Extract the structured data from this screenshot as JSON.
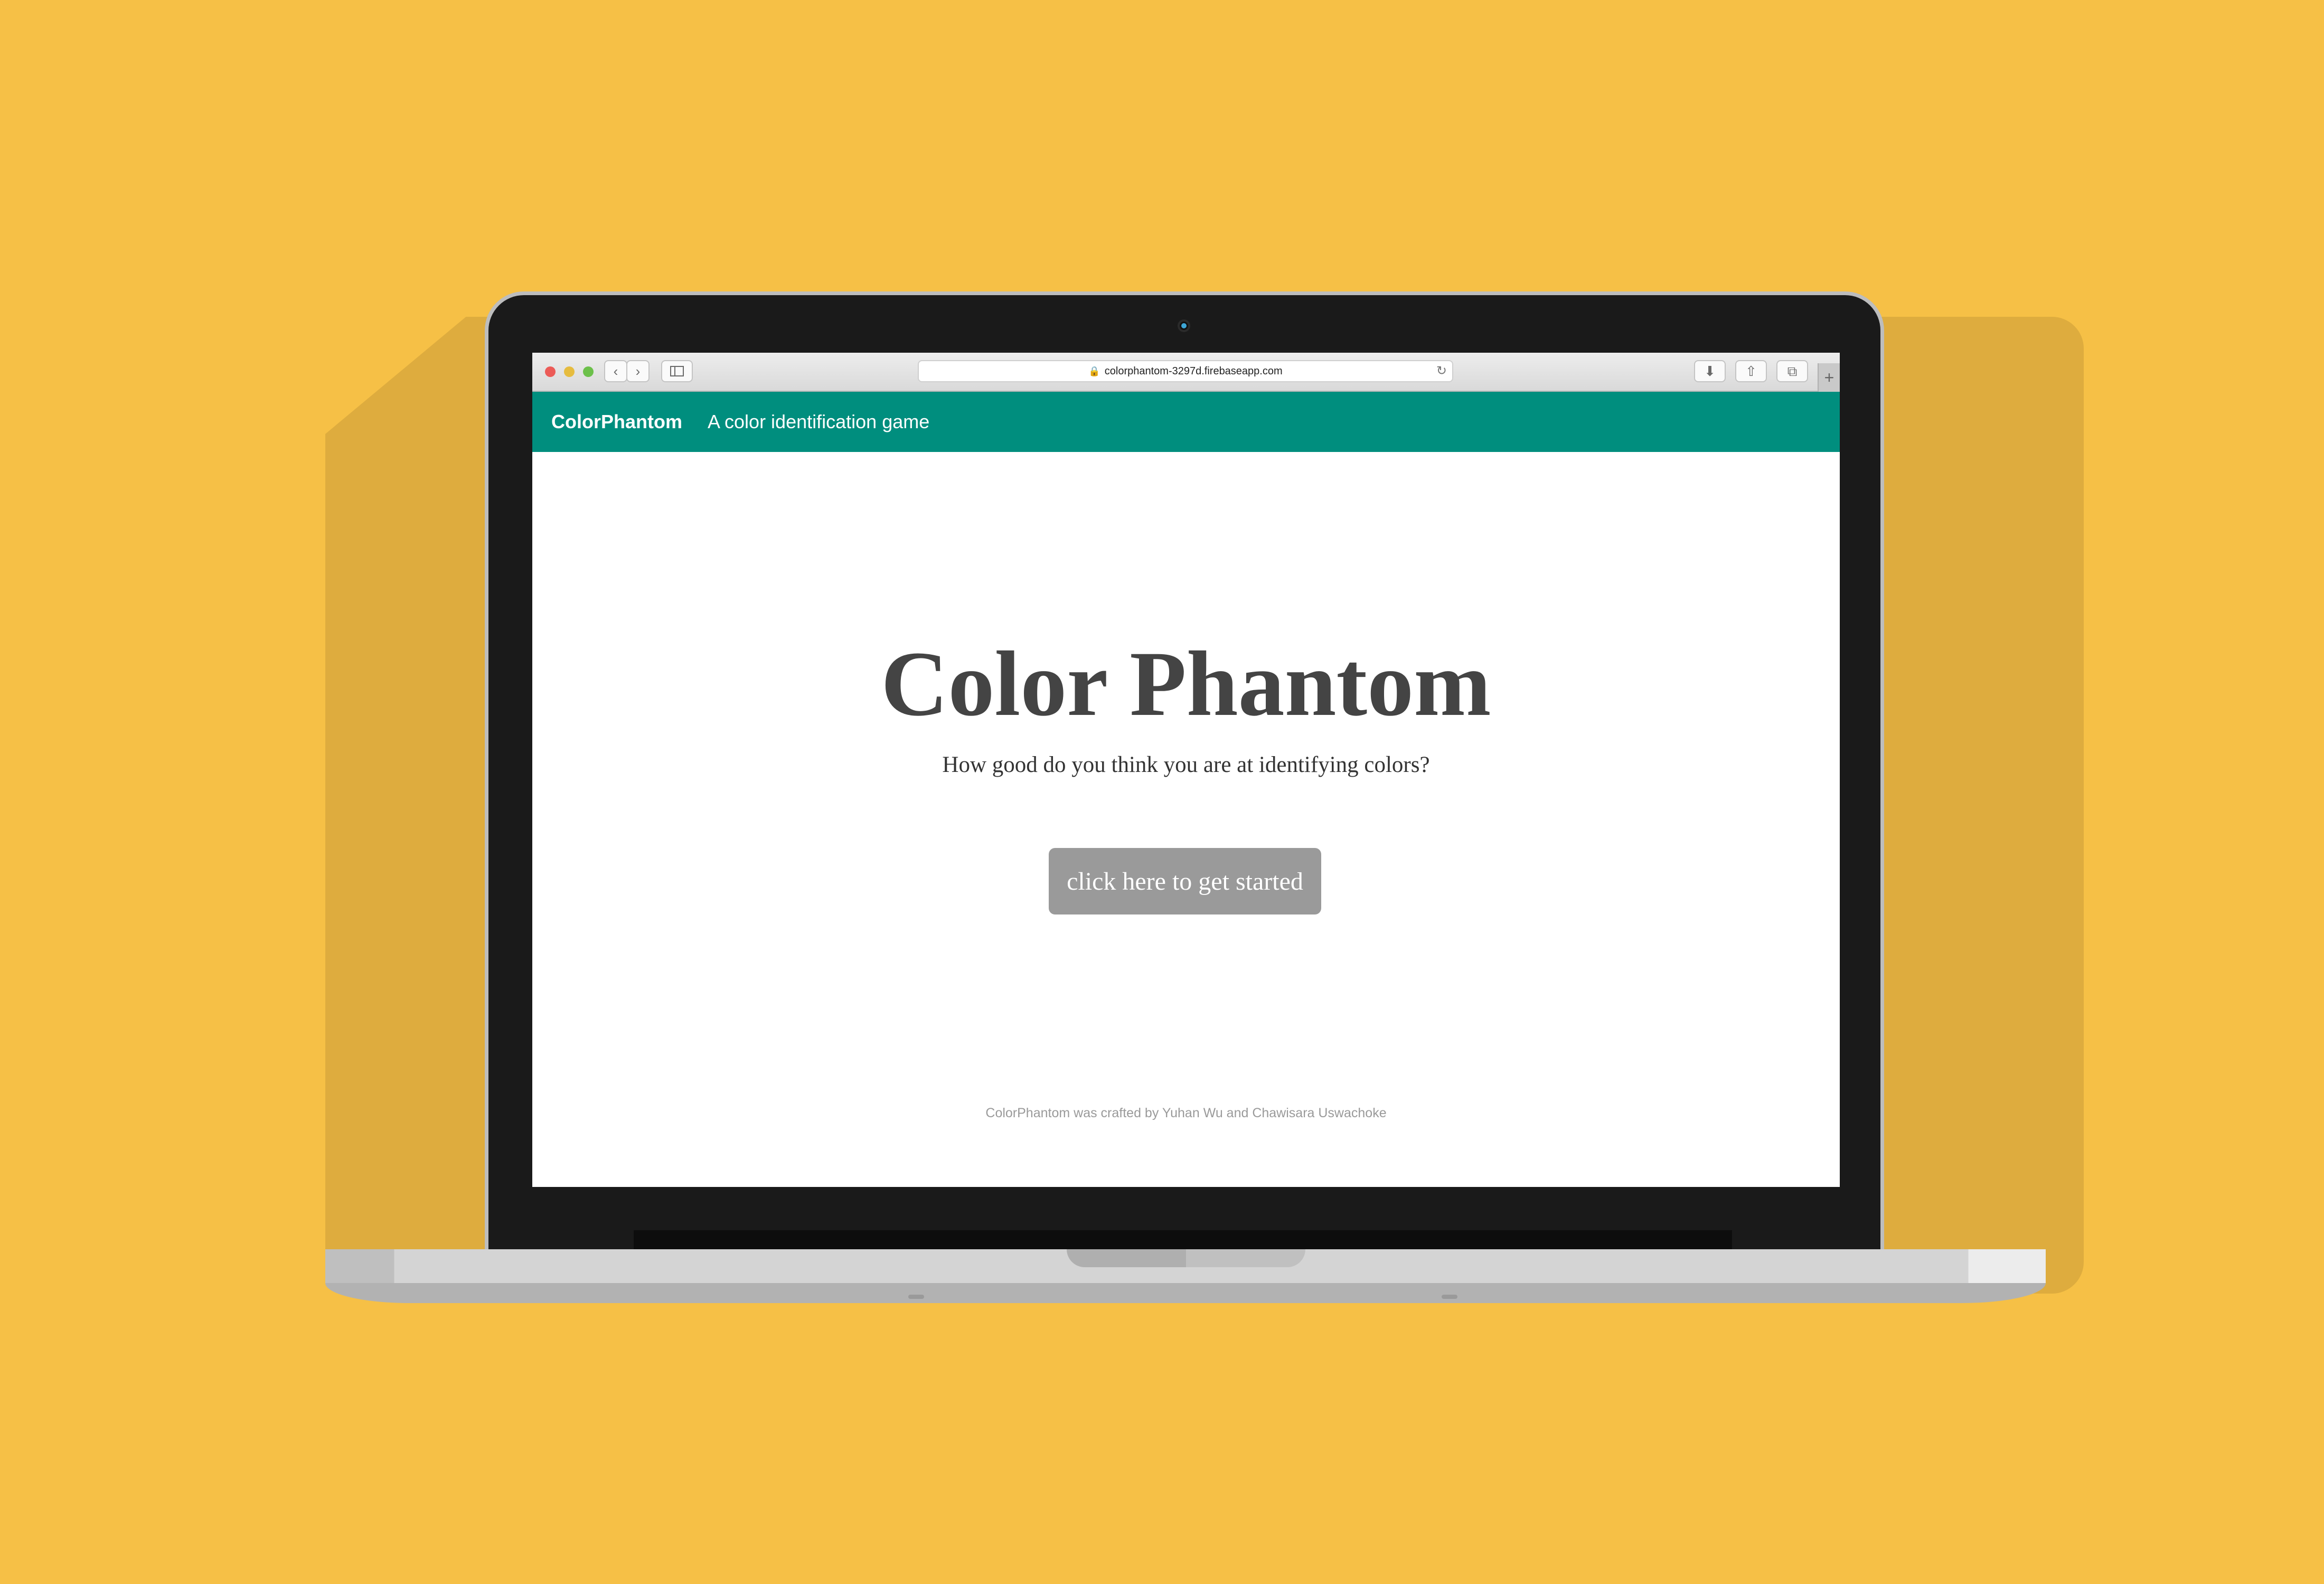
{
  "browser": {
    "url": "colorphantom-3297d.firebaseapp.com",
    "icons": {
      "back": "chevron-left-icon",
      "forward": "chevron-right-icon",
      "sidebar": "sidebar-icon",
      "lock": "lock-icon",
      "reload": "reload-icon",
      "downloads": "download-icon",
      "share": "share-icon",
      "tabs": "tabs-icon",
      "new_tab": "plus-icon"
    }
  },
  "navbar": {
    "brand": "ColorPhantom",
    "tagline": "A color identification game"
  },
  "main": {
    "title": "Color Phantom",
    "subtitle": "How good do you think you are at identifying colors?",
    "start_button": "click here to get started"
  },
  "footer": {
    "credits": "ColorPhantom was crafted by Yuhan Wu and Chawisara Uswachoke"
  },
  "colors": {
    "background": "#F6C046",
    "navbar": "#008E7E",
    "button": "#9A9A9A",
    "title_text": "#444444"
  }
}
